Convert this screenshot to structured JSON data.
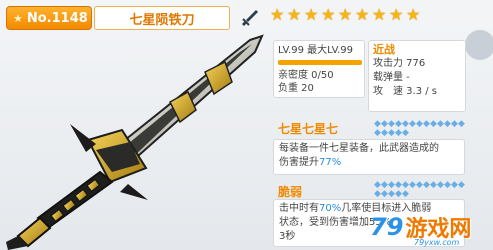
{
  "header": {
    "number": "No.1148",
    "weapon_name": "七星陨铁刀",
    "type_icon": "sword-icon",
    "stars": 9,
    "star_glyph": "★"
  },
  "level": {
    "text": "LV.99 最大LV.99",
    "progress": 1.0,
    "intimacy": "亲密度 0/50",
    "weight": "负重 20"
  },
  "attack": {
    "type": "近战",
    "power": "攻击力 776",
    "ammo": "载弹量 -",
    "speed": "攻　速 3.3 / s"
  },
  "skill1": {
    "title": "七星七星七",
    "line1": "每装备一件七星装备，此武器造成的",
    "line2_prefix": "伤害提升",
    "line2_value": "77%",
    "diamonds": 18
  },
  "skill2": {
    "title": "脆弱",
    "line1_prefix": "击中时有",
    "line1_value": "70%",
    "line1_suffix": "几率使目标进入脆弱",
    "line2": "状态，受到伤害增加55%",
    "line3": "3秒",
    "diamonds": 18
  },
  "watermark": {
    "number": "79",
    "text": "游戏网",
    "url": "79yxw.com"
  },
  "colors": {
    "accent": "#f08a00",
    "highlight": "#2b8ee0",
    "star": "#f7b515"
  }
}
